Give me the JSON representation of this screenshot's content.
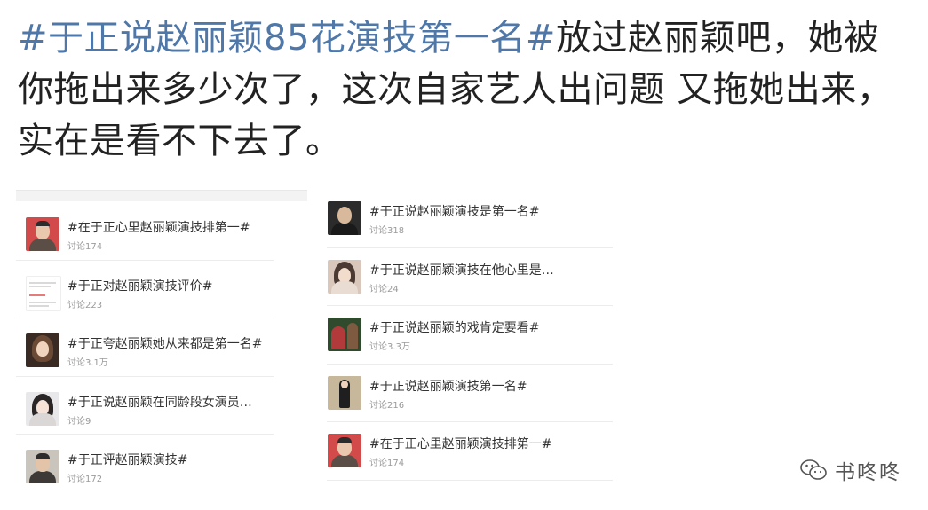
{
  "post": {
    "hashtag": "#于正说赵丽颖85花演技第一名#",
    "body": "放过赵丽颖吧，她被你拖出来多少次了，这次自家艺人出问题 又拖她出来，实在是看不下去了。"
  },
  "topics_left": [
    {
      "title": "#在于正心里赵丽颖演技排第一#",
      "count": "讨论174",
      "thumb": "man-face"
    },
    {
      "title": "#于正对赵丽颖演技评价#",
      "count": "讨论223",
      "thumb": "document"
    },
    {
      "title": "#于正夸赵丽颖她从来都是第一名#",
      "count": "讨论3.1万",
      "thumb": "woman-face-dark"
    },
    {
      "title": "#于正说赵丽颖在同龄段女演员…",
      "count": "讨论9",
      "thumb": "woman-face-light"
    },
    {
      "title": "#于正评赵丽颖演技#",
      "count": "讨论172",
      "thumb": "man-face"
    }
  ],
  "topics_right": [
    {
      "title": "#于正说赵丽颖演技是第一名#",
      "count": "讨论318",
      "thumb": "man-face-dark"
    },
    {
      "title": "#于正说赵丽颖演技在他心里是…",
      "count": "讨论24",
      "thumb": "woman-face-light"
    },
    {
      "title": "#于正说赵丽颖的戏肯定要看#",
      "count": "讨论3.3万",
      "thumb": "drama-still"
    },
    {
      "title": "#于正说赵丽颖演技第一名#",
      "count": "讨论216",
      "thumb": "woman-standing"
    },
    {
      "title": "#在于正心里赵丽颖演技排第一#",
      "count": "讨论174",
      "thumb": "man-face"
    }
  ],
  "watermark": {
    "text": "书咚咚",
    "icon": "wechat-icon"
  },
  "colors": {
    "hashtag": "#4f78a8",
    "text": "#222222",
    "count": "#9a9a9a"
  }
}
